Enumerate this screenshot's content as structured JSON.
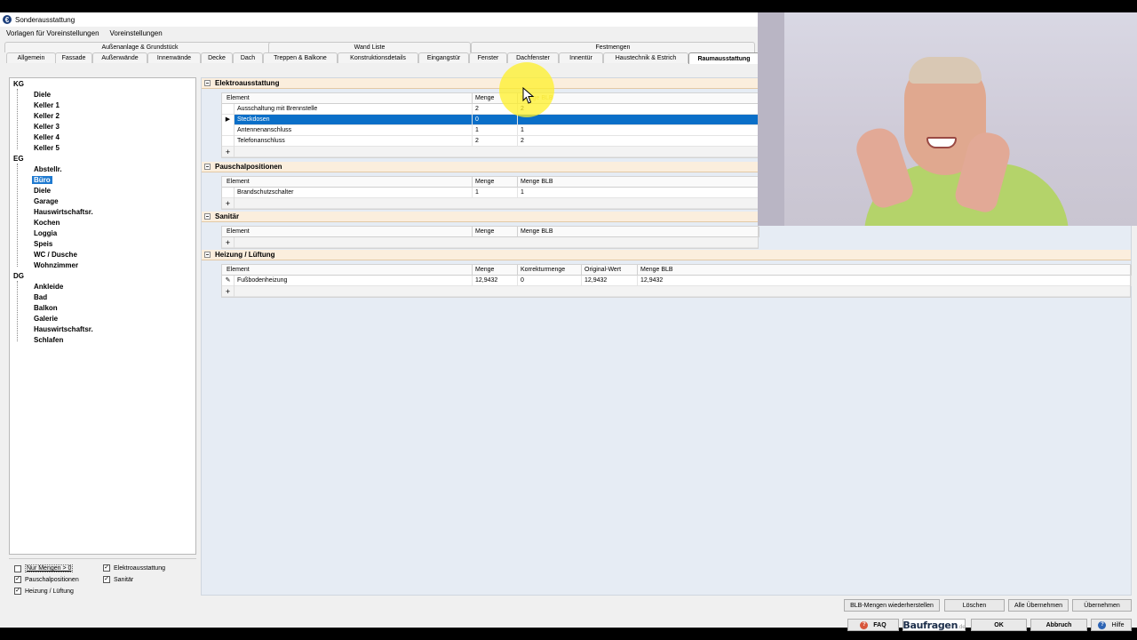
{
  "window": {
    "title": "Sonderausstattung",
    "icon": "euro-app-icon",
    "menu": [
      "Vorlagen für Voreinstellungen",
      "Voreinstellungen"
    ]
  },
  "tabs_row1": [
    "Außenanlage & Grundstück",
    "Wand Liste",
    "Festmengen"
  ],
  "tabs_row2": [
    "Allgemein",
    "Fassade",
    "Außenwände",
    "Innenwände",
    "Decke",
    "Dach",
    "Treppen & Balkone",
    "Konstruktionsdetails",
    "Eingangstür",
    "Fenster",
    "Dachfenster",
    "Innentür",
    "Haustechnik & Estrich",
    "Raumausstattung"
  ],
  "active_tab": "Raumausstattung",
  "tree": [
    {
      "label": "KG",
      "level": 0
    },
    {
      "label": "Diele",
      "level": 1
    },
    {
      "label": "Keller 1",
      "level": 1
    },
    {
      "label": "Keller 2",
      "level": 1
    },
    {
      "label": "Keller 3",
      "level": 1
    },
    {
      "label": "Keller 4",
      "level": 1
    },
    {
      "label": "Keller 5",
      "level": 1
    },
    {
      "label": "EG",
      "level": 0
    },
    {
      "label": "Abstellr.",
      "level": 1
    },
    {
      "label": "Büro",
      "level": 1,
      "selected": true
    },
    {
      "label": "Diele",
      "level": 1
    },
    {
      "label": "Garage",
      "level": 1
    },
    {
      "label": "Hauswirtschaftsr.",
      "level": 1
    },
    {
      "label": "Kochen",
      "level": 1
    },
    {
      "label": "Loggia",
      "level": 1
    },
    {
      "label": "Speis",
      "level": 1
    },
    {
      "label": "WC / Dusche",
      "level": 1
    },
    {
      "label": "Wohnzimmer",
      "level": 1
    },
    {
      "label": "DG",
      "level": 0
    },
    {
      "label": "Ankleide",
      "level": 1
    },
    {
      "label": "Bad",
      "level": 1
    },
    {
      "label": "Balkon",
      "level": 1
    },
    {
      "label": "Galerie",
      "level": 1
    },
    {
      "label": "Hauswirtschaftsr.",
      "level": 1
    },
    {
      "label": "Schlafen",
      "level": 1
    }
  ],
  "filters": {
    "nur_mengen": {
      "label": "Nur Mengen > 0",
      "checked": false
    },
    "elektro": {
      "label": "Elektroausstattung",
      "checked": true
    },
    "pauschal": {
      "label": "Pauschalpositionen",
      "checked": true
    },
    "sanitaer": {
      "label": "Sanitär",
      "checked": true
    },
    "heizung": {
      "label": "Heizung / Lüftung",
      "checked": true
    }
  },
  "sections": {
    "elektro": {
      "title": "Elektroausstattung",
      "headers": [
        "Element",
        "Menge",
        "Menge BLB"
      ],
      "rows": [
        [
          "Ausschaltung mit Brennstelle",
          "2",
          "2"
        ],
        [
          "Steckdosen",
          "0",
          ""
        ],
        [
          "Antennenanschluss",
          "1",
          "1"
        ],
        [
          "Telefonanschluss",
          "2",
          "2"
        ]
      ]
    },
    "pauschal": {
      "title": "Pauschalpositionen",
      "headers": [
        "Element",
        "Menge",
        "Menge BLB"
      ],
      "rows": [
        [
          "Brandschutzschalter",
          "1",
          "1"
        ]
      ]
    },
    "sanitaer": {
      "title": "Sanitär",
      "headers": [
        "Element",
        "Menge",
        "Menge BLB"
      ],
      "rows": []
    },
    "heizung": {
      "title": "Heizung / Lüftung",
      "headers": [
        "Element",
        "Menge",
        "Korrekturmenge",
        "Original-Wert",
        "Menge BLB"
      ],
      "rows": [
        [
          "Fußbodenheizung",
          "12,9432",
          "0",
          "12,9432",
          "12,9432"
        ]
      ]
    }
  },
  "buttons": {
    "restore": "BLB-Mengen wiederherstellen",
    "delete": "Löschen",
    "apply_all": "Alle Übernehmen",
    "apply": "Übernehmen",
    "faq": "FAQ",
    "logo": "Baufragen",
    "logo_suffix": ".de",
    "ok": "OK",
    "cancel": "Abbruch",
    "help": "Hilfe"
  },
  "colors": {
    "selection": "#0a6fc8",
    "section_header": "#fbeedd",
    "highlight": "#fff028"
  }
}
